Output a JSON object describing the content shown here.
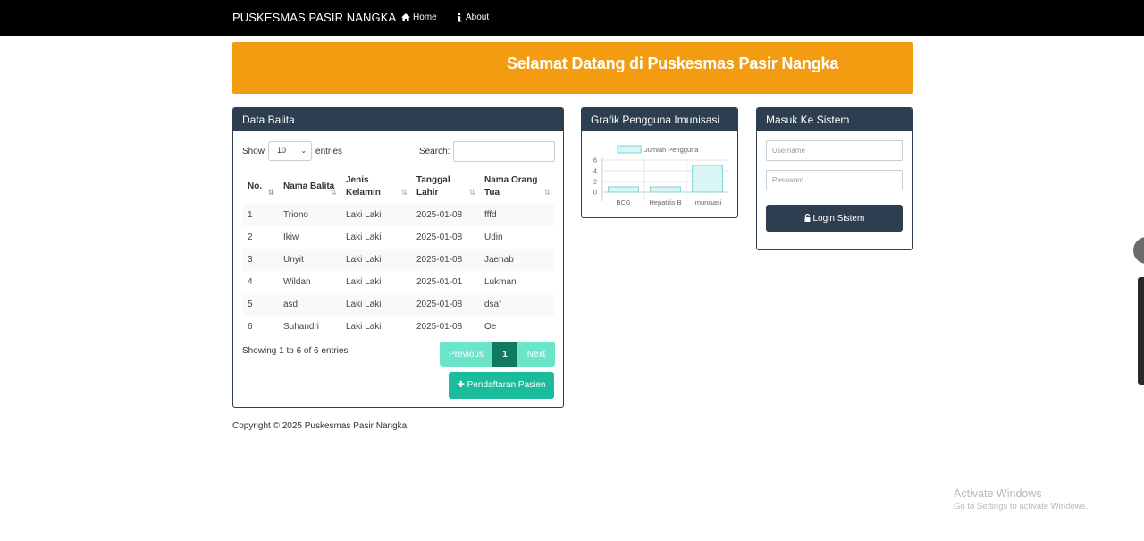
{
  "navbar": {
    "brand": "PUSKESMAS PASIR NANGKA",
    "links": [
      {
        "label": "Home",
        "icon": "home-icon"
      },
      {
        "label": "About",
        "icon": "info-icon"
      }
    ]
  },
  "banner": {
    "text": "Selamat Datang di Puskesmas Pasir Nangka"
  },
  "balita": {
    "title": "Data Balita",
    "show_label": "Show",
    "length_value": "10",
    "entries_label": "entries",
    "search_label": "Search:",
    "search_value": "",
    "columns": [
      "No.",
      "Nama Balita",
      "Jenis Kelamin",
      "Tanggal Lahir",
      "Nama Orang Tua"
    ],
    "rows": [
      [
        "1",
        "Triono",
        "Laki Laki",
        "2025-01-08",
        "fffd"
      ],
      [
        "2",
        "Ikiw",
        "Laki Laki",
        "2025-01-08",
        "Udin"
      ],
      [
        "3",
        "Unyit",
        "Laki Laki",
        "2025-01-08",
        "Jaenab"
      ],
      [
        "4",
        "Wildan",
        "Laki Laki",
        "2025-01-01",
        "Lukman"
      ],
      [
        "5",
        "asd",
        "Laki Laki",
        "2025-01-08",
        "dsaf"
      ],
      [
        "6",
        "Suhandri",
        "Laki Laki",
        "2025-01-08",
        "Oe"
      ]
    ],
    "info": "Showing 1 to 6 of 6 entries",
    "pager": {
      "previous": "Previous",
      "current": "1",
      "next": "Next"
    },
    "register_button": "Pendaftaran Pasien"
  },
  "grafik": {
    "title": "Grafik Pengguna Imunisasi",
    "chart_data": {
      "type": "bar",
      "categories": [
        "BCG",
        "Hepatitis B",
        "Imunisasi"
      ],
      "series": [
        {
          "name": "Jumlah Pengguna",
          "values": [
            1,
            1,
            5
          ]
        }
      ],
      "yticks": [
        "0",
        "2",
        "4",
        "6"
      ],
      "ylim": [
        0,
        6
      ],
      "legend": "top",
      "bar_fill": "#d9f5f5",
      "bar_stroke": "#7fd3d3"
    }
  },
  "login": {
    "title": "Masuk Ke Sistem",
    "username_placeholder": "Username",
    "password_placeholder": "Password",
    "button": "Login Sistem"
  },
  "footer": {
    "copyright": "Copyright © 2025 Puskesmas Pasir Nangka"
  },
  "watermark": {
    "line1": "Activate Windows",
    "line2": "Go to Settings to activate Windows."
  },
  "colors": {
    "navbar": "#000000",
    "banner": "#f39c12",
    "panel_header": "#2c3e50",
    "accent": "#1abc9c"
  }
}
